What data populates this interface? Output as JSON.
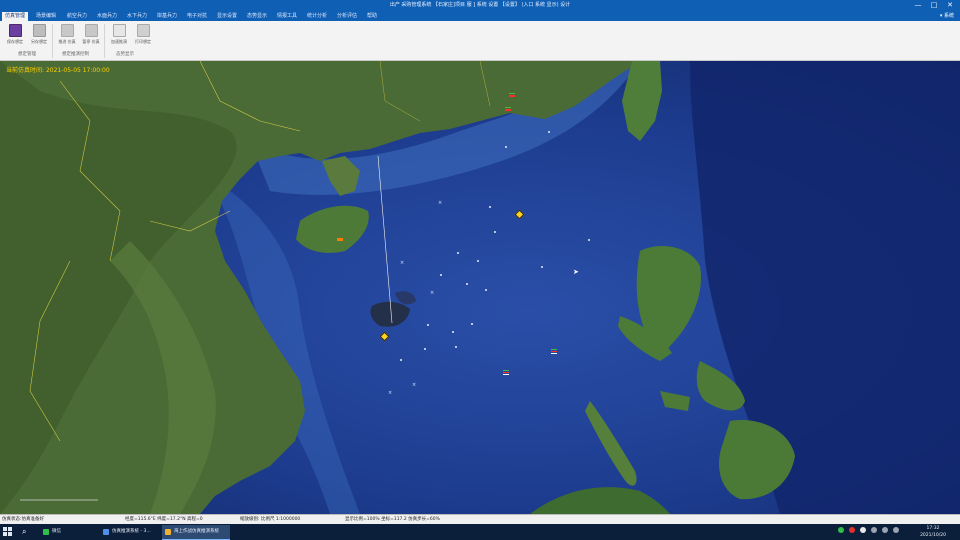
{
  "window": {
    "title": "出产 采购管理系统 【石家庄]项目 服 ] 系统 设置 【设置】 (入口 系统 显示) 设计",
    "minimize": "—",
    "maximize": "□",
    "close": "✕"
  },
  "menu": {
    "tabs": [
      "仿真管理",
      "场景编辑",
      "航空兵力",
      "水面兵力",
      "水下兵力",
      "岸基兵力",
      "电子对抗",
      "显示设置",
      "态势显示",
      "情报工具",
      "统计分析",
      "分析评估",
      "帮助"
    ],
    "active_index": 0,
    "right_label": "▾ 系统"
  },
  "ribbon": {
    "buttons": [
      {
        "label": "保存想定",
        "icon": "save-icon"
      },
      {
        "label": "另存想定",
        "icon": "save-as-icon"
      },
      {
        "label": "推进 仿真",
        "icon": "play-icon"
      },
      {
        "label": "暂停 仿真",
        "icon": "pause-icon"
      },
      {
        "label": "加速推演",
        "icon": "document-icon"
      },
      {
        "label": "打印想定",
        "icon": "print-icon"
      }
    ],
    "groups": [
      "想定管理",
      "想定推演控制",
      "态势显示"
    ]
  },
  "map": {
    "sim_time_label": "当前仿真时间",
    "sim_time_value": "2021-05-05 17:00:00"
  },
  "statusbar": {
    "left": "仿真状态:仿真准备好",
    "coords": "经度=115.6°E 纬度=17.2°N 高程=0",
    "middle": "缩放级别: 比例尺 1:1000000",
    "right": "显示比例=100% 坐标=117.2 仿真步长=60%"
  },
  "taskbar": {
    "items": [
      {
        "label": "微信"
      },
      {
        "label": "仿真推演系统 - 3..."
      },
      {
        "label": "海上作战仿真推演系统"
      }
    ],
    "active_index": 2,
    "time": "17:32",
    "date": "2021/10/20"
  },
  "colors": {
    "titlebar": "#0f5fb4",
    "ribbon_bg": "#f3f3f3",
    "sim_time": "#ffd400",
    "sea": "#1a3a8f",
    "land": "#3b6b35"
  }
}
